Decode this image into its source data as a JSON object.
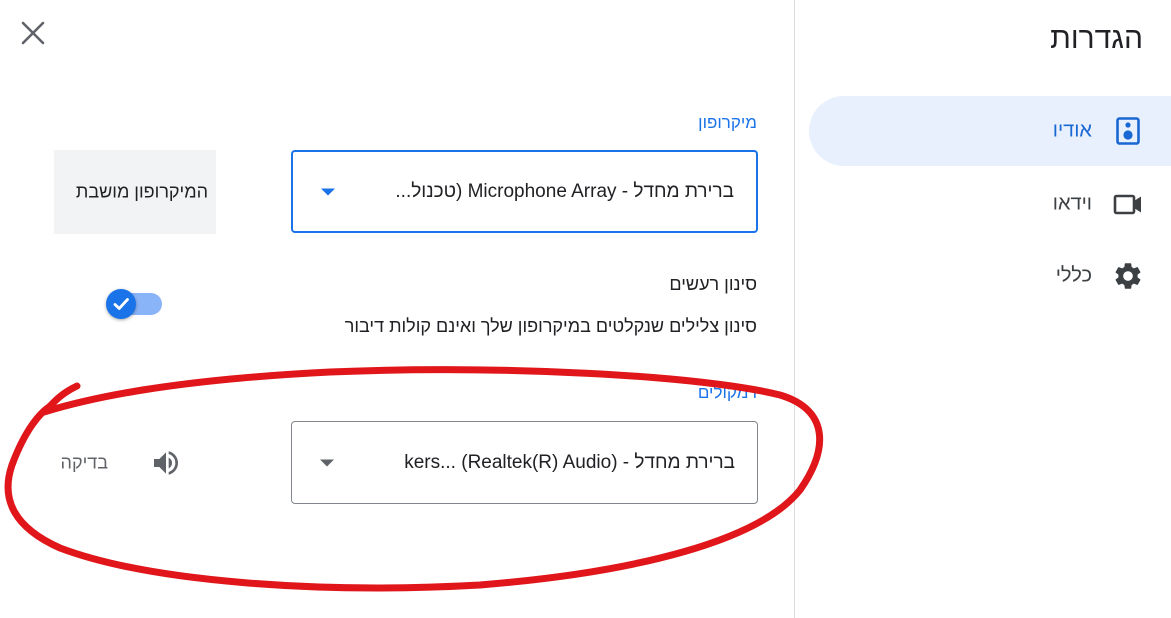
{
  "close": {
    "icon": "close-icon"
  },
  "sidebar": {
    "title": "הגדרות",
    "items": [
      {
        "label": "אודיו",
        "icon": "speaker-icon",
        "active": true
      },
      {
        "label": "וידאו",
        "icon": "video-camera-icon",
        "active": false
      },
      {
        "label": "כללי",
        "icon": "gear-icon",
        "active": false
      }
    ]
  },
  "microphone": {
    "label": "מיקרופון",
    "value": "ברירת מחדל - Microphone Array (טכנול...",
    "muted_label": "המיקרופון מושבת"
  },
  "noise_cancellation": {
    "title": "סינון רעשים",
    "description": "סינון צלילים שנקלטים במיקרופון שלך ואינם קולות דיבור",
    "enabled": true
  },
  "speakers": {
    "label": "רמקולים",
    "value": "ברירת מחדל - (Realtek(R) Audio) ...kers",
    "test_label": "בדיקה"
  },
  "colors": {
    "accent": "#1a73e8",
    "active_nav_bg": "#e8f0fe",
    "annotation_red": "#e0161b"
  }
}
